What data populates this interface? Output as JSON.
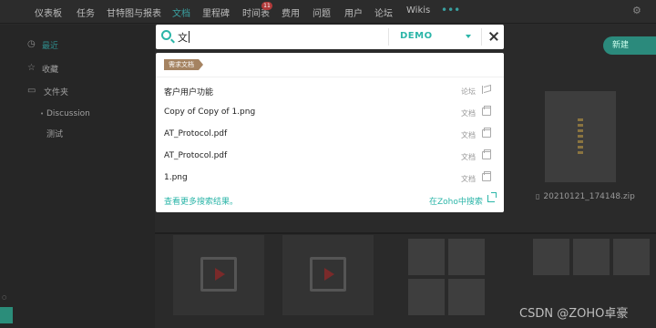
{
  "nav": {
    "items": [
      "仪表板",
      "任务",
      "甘特图与报表",
      "文档",
      "里程碑",
      "时间表",
      "费用",
      "问题",
      "用户",
      "论坛",
      "Wikis"
    ],
    "active": "文档",
    "timesheet_badge": "11",
    "more": "•••"
  },
  "sidebar": {
    "items": [
      {
        "label": "最近",
        "icon": "clock-icon"
      },
      {
        "label": "收藏",
        "icon": "star-icon"
      },
      {
        "label": "文件夹",
        "icon": "folder-icon"
      },
      {
        "label": "Discussion",
        "icon": "bullet-icon"
      },
      {
        "label": "测试",
        "icon": ""
      }
    ]
  },
  "main": {
    "new_button": "新建",
    "zip_file_name": "20210121_174148.zip"
  },
  "search": {
    "query": "文",
    "portal": "DEMO",
    "category_tag": "需求文档",
    "results": [
      {
        "title": "客户用户功能",
        "module": "论坛",
        "icon": "forum-icon"
      },
      {
        "title": "Copy of Copy of 1.png",
        "module": "文档",
        "icon": "document-icon"
      },
      {
        "title": "AT_Protocol.pdf",
        "module": "文档",
        "icon": "document-icon"
      },
      {
        "title": "AT_Protocol.pdf",
        "module": "文档",
        "icon": "document-icon"
      },
      {
        "title": "1.png",
        "module": "文档",
        "icon": "document-icon"
      }
    ],
    "more_results_link": "查看更多搜索结果。",
    "search_in_zoho_link": "在Zoho中搜索"
  },
  "watermark": "CSDN @ZOHO卓豪",
  "colors": {
    "accent": "#2bb5a8",
    "tag": "#a58361",
    "overlay_bg": "#2a2a2a"
  }
}
